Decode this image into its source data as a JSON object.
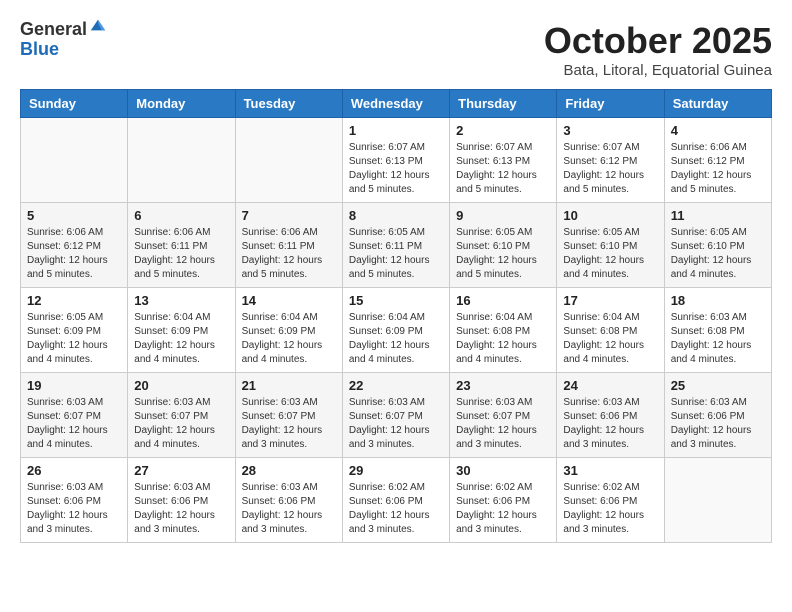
{
  "logo": {
    "general": "General",
    "blue": "Blue"
  },
  "title": "October 2025",
  "location": "Bata, Litoral, Equatorial Guinea",
  "days_of_week": [
    "Sunday",
    "Monday",
    "Tuesday",
    "Wednesday",
    "Thursday",
    "Friday",
    "Saturday"
  ],
  "weeks": [
    [
      {
        "day": "",
        "info": ""
      },
      {
        "day": "",
        "info": ""
      },
      {
        "day": "",
        "info": ""
      },
      {
        "day": "1",
        "info": "Sunrise: 6:07 AM\nSunset: 6:13 PM\nDaylight: 12 hours\nand 5 minutes."
      },
      {
        "day": "2",
        "info": "Sunrise: 6:07 AM\nSunset: 6:13 PM\nDaylight: 12 hours\nand 5 minutes."
      },
      {
        "day": "3",
        "info": "Sunrise: 6:07 AM\nSunset: 6:12 PM\nDaylight: 12 hours\nand 5 minutes."
      },
      {
        "day": "4",
        "info": "Sunrise: 6:06 AM\nSunset: 6:12 PM\nDaylight: 12 hours\nand 5 minutes."
      }
    ],
    [
      {
        "day": "5",
        "info": "Sunrise: 6:06 AM\nSunset: 6:12 PM\nDaylight: 12 hours\nand 5 minutes."
      },
      {
        "day": "6",
        "info": "Sunrise: 6:06 AM\nSunset: 6:11 PM\nDaylight: 12 hours\nand 5 minutes."
      },
      {
        "day": "7",
        "info": "Sunrise: 6:06 AM\nSunset: 6:11 PM\nDaylight: 12 hours\nand 5 minutes."
      },
      {
        "day": "8",
        "info": "Sunrise: 6:05 AM\nSunset: 6:11 PM\nDaylight: 12 hours\nand 5 minutes."
      },
      {
        "day": "9",
        "info": "Sunrise: 6:05 AM\nSunset: 6:10 PM\nDaylight: 12 hours\nand 5 minutes."
      },
      {
        "day": "10",
        "info": "Sunrise: 6:05 AM\nSunset: 6:10 PM\nDaylight: 12 hours\nand 4 minutes."
      },
      {
        "day": "11",
        "info": "Sunrise: 6:05 AM\nSunset: 6:10 PM\nDaylight: 12 hours\nand 4 minutes."
      }
    ],
    [
      {
        "day": "12",
        "info": "Sunrise: 6:05 AM\nSunset: 6:09 PM\nDaylight: 12 hours\nand 4 minutes."
      },
      {
        "day": "13",
        "info": "Sunrise: 6:04 AM\nSunset: 6:09 PM\nDaylight: 12 hours\nand 4 minutes."
      },
      {
        "day": "14",
        "info": "Sunrise: 6:04 AM\nSunset: 6:09 PM\nDaylight: 12 hours\nand 4 minutes."
      },
      {
        "day": "15",
        "info": "Sunrise: 6:04 AM\nSunset: 6:09 PM\nDaylight: 12 hours\nand 4 minutes."
      },
      {
        "day": "16",
        "info": "Sunrise: 6:04 AM\nSunset: 6:08 PM\nDaylight: 12 hours\nand 4 minutes."
      },
      {
        "day": "17",
        "info": "Sunrise: 6:04 AM\nSunset: 6:08 PM\nDaylight: 12 hours\nand 4 minutes."
      },
      {
        "day": "18",
        "info": "Sunrise: 6:03 AM\nSunset: 6:08 PM\nDaylight: 12 hours\nand 4 minutes."
      }
    ],
    [
      {
        "day": "19",
        "info": "Sunrise: 6:03 AM\nSunset: 6:07 PM\nDaylight: 12 hours\nand 4 minutes."
      },
      {
        "day": "20",
        "info": "Sunrise: 6:03 AM\nSunset: 6:07 PM\nDaylight: 12 hours\nand 4 minutes."
      },
      {
        "day": "21",
        "info": "Sunrise: 6:03 AM\nSunset: 6:07 PM\nDaylight: 12 hours\nand 3 minutes."
      },
      {
        "day": "22",
        "info": "Sunrise: 6:03 AM\nSunset: 6:07 PM\nDaylight: 12 hours\nand 3 minutes."
      },
      {
        "day": "23",
        "info": "Sunrise: 6:03 AM\nSunset: 6:07 PM\nDaylight: 12 hours\nand 3 minutes."
      },
      {
        "day": "24",
        "info": "Sunrise: 6:03 AM\nSunset: 6:06 PM\nDaylight: 12 hours\nand 3 minutes."
      },
      {
        "day": "25",
        "info": "Sunrise: 6:03 AM\nSunset: 6:06 PM\nDaylight: 12 hours\nand 3 minutes."
      }
    ],
    [
      {
        "day": "26",
        "info": "Sunrise: 6:03 AM\nSunset: 6:06 PM\nDaylight: 12 hours\nand 3 minutes."
      },
      {
        "day": "27",
        "info": "Sunrise: 6:03 AM\nSunset: 6:06 PM\nDaylight: 12 hours\nand 3 minutes."
      },
      {
        "day": "28",
        "info": "Sunrise: 6:03 AM\nSunset: 6:06 PM\nDaylight: 12 hours\nand 3 minutes."
      },
      {
        "day": "29",
        "info": "Sunrise: 6:02 AM\nSunset: 6:06 PM\nDaylight: 12 hours\nand 3 minutes."
      },
      {
        "day": "30",
        "info": "Sunrise: 6:02 AM\nSunset: 6:06 PM\nDaylight: 12 hours\nand 3 minutes."
      },
      {
        "day": "31",
        "info": "Sunrise: 6:02 AM\nSunset: 6:06 PM\nDaylight: 12 hours\nand 3 minutes."
      },
      {
        "day": "",
        "info": ""
      }
    ]
  ]
}
